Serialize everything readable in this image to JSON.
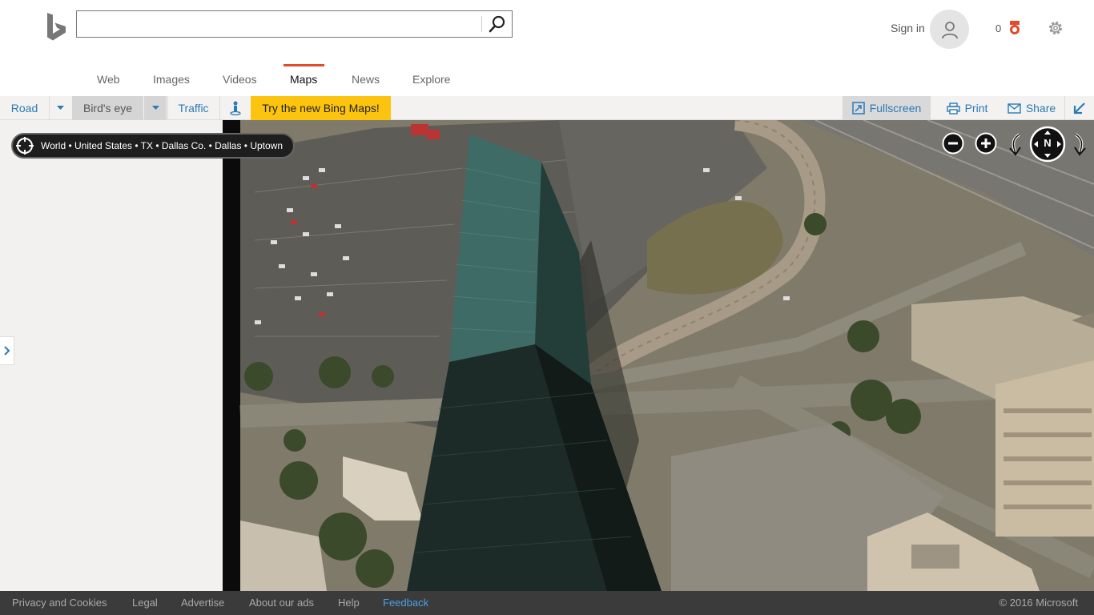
{
  "search": {
    "value": "",
    "placeholder": ""
  },
  "header": {
    "sign_in": "Sign in",
    "rewards_count": "0"
  },
  "nav_tabs": [
    {
      "label": "Web"
    },
    {
      "label": "Images"
    },
    {
      "label": "Videos"
    },
    {
      "label": "Maps",
      "active": true
    },
    {
      "label": "News"
    },
    {
      "label": "Explore"
    }
  ],
  "toolbar": {
    "road": "Road",
    "birds_eye": "Bird's eye",
    "traffic": "Traffic",
    "try_new": "Try the new Bing Maps!",
    "fullscreen": "Fullscreen",
    "print": "Print",
    "share": "Share"
  },
  "breadcrumb": "World • United States • TX • Dallas Co. • Dallas • Uptown",
  "map_controls": {
    "compass": "N"
  },
  "footer": {
    "links": [
      "Privacy and Cookies",
      "Legal",
      "Advertise",
      "About our ads",
      "Help",
      "Feedback"
    ],
    "copyright": "© 2016 Microsoft"
  },
  "colors": {
    "accent": "#de4c2c",
    "link": "#2a7ab8",
    "try_new_bg": "#fcc40e",
    "footer_bg": "#3b3b3b"
  }
}
